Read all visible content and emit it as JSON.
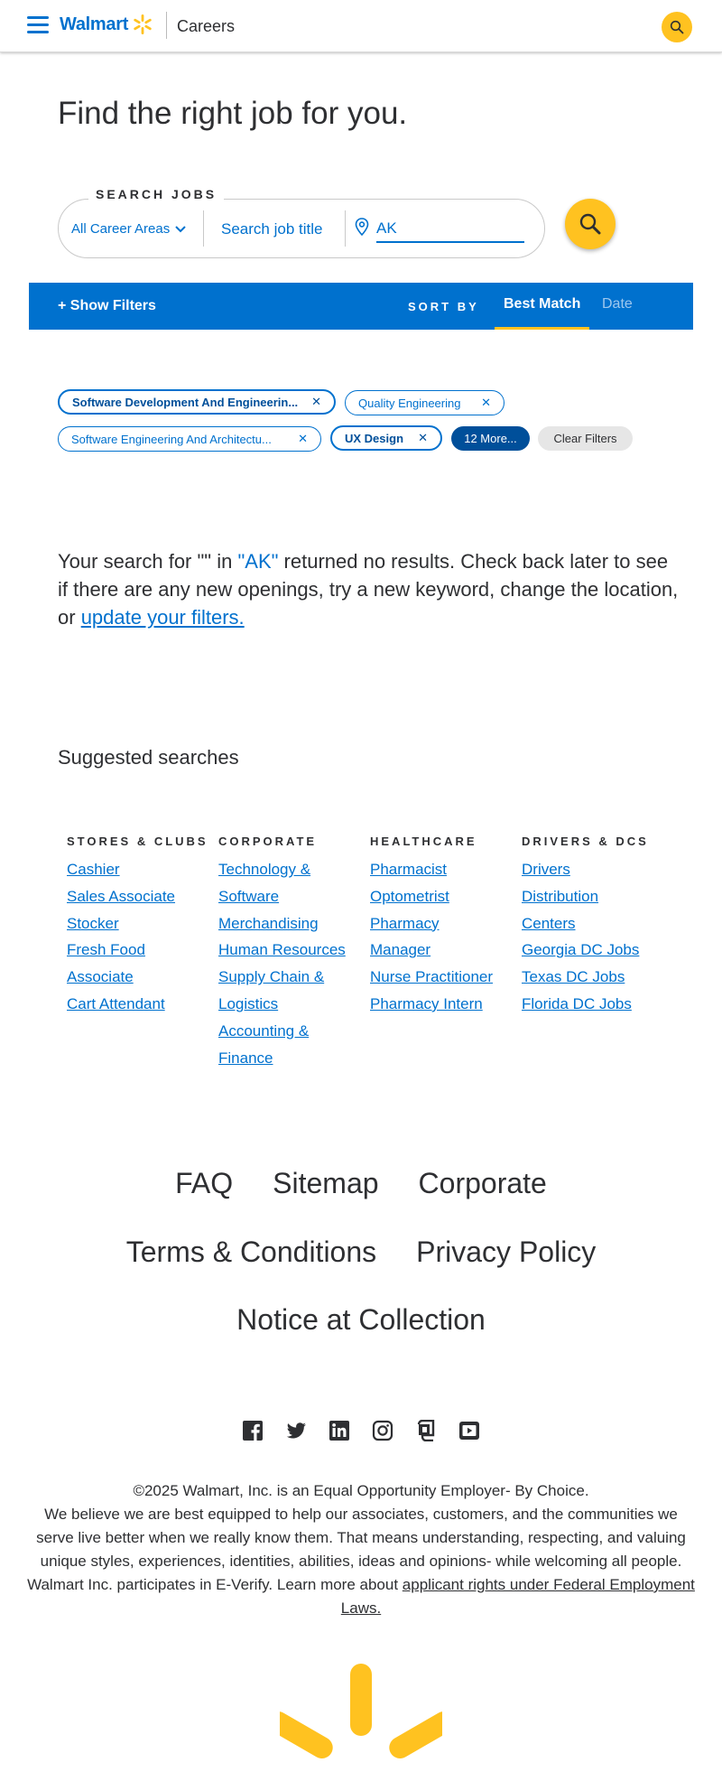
{
  "header": {
    "logo_text": "Walmart",
    "section": "Careers"
  },
  "hero": {
    "title": "Find the right job for you.",
    "search_label": "SEARCH JOBS",
    "career_area": "All Career Areas",
    "job_title_placeholder": "Search job title",
    "location_value": "AK"
  },
  "filter_bar": {
    "show_filters": "+ Show Filters",
    "sort_by": "SORT BY",
    "sort_best": "Best Match",
    "sort_date": "Date"
  },
  "chips": [
    {
      "label": "Software Development And Engineerin...",
      "bold": true
    },
    {
      "label": "Quality Engineering",
      "bold": false
    },
    {
      "label": "Software Engineering And Architectu...",
      "bold": false
    },
    {
      "label": "UX Design",
      "bold": true
    }
  ],
  "chip_more": "12 More...",
  "chip_clear": "Clear Filters",
  "no_results": {
    "prefix": "Your search for \"\" in ",
    "location": "\"AK\"",
    "middle": " returned no results. Check back later to see if there are any new openings, try a new keyword, change the location, or ",
    "link": "update your filters."
  },
  "suggested": {
    "title": "Suggested searches",
    "columns": [
      {
        "heading": "STORES & CLUBS",
        "links": [
          "Cashier",
          "Sales Associate",
          "Stocker",
          "Fresh Food",
          "Associate",
          "Cart Attendant"
        ]
      },
      {
        "heading": "CORPORATE",
        "links": [
          "Technology &",
          "Software",
          "Merchandising",
          "Human Resources",
          "Supply Chain &",
          "Logistics",
          "Accounting &",
          "Finance"
        ]
      },
      {
        "heading": "HEALTHCARE",
        "links": [
          "Pharmacist",
          "Optometrist",
          "Pharmacy",
          "Manager",
          "Nurse Practitioner",
          "Pharmacy Intern"
        ]
      },
      {
        "heading": "DRIVERS & DCS",
        "links": [
          "Drivers",
          "Distribution",
          "Centers",
          "Georgia DC Jobs",
          "Texas DC Jobs",
          "Florida DC Jobs"
        ]
      }
    ]
  },
  "footer": {
    "links_row1": [
      "FAQ",
      "Sitemap",
      "Corporate"
    ],
    "links_row2": [
      "Terms & Conditions",
      "Privacy Policy"
    ],
    "links_row3": [
      "Notice at Collection"
    ],
    "social_icons": [
      "facebook-icon",
      "twitter-icon",
      "linkedin-icon",
      "instagram-icon",
      "glassdoor-icon",
      "youtube-icon"
    ],
    "legal_line1": "©2025 Walmart, Inc. is an Equal Opportunity Employer- By Choice.",
    "legal_body": "We believe we are best equipped to help our associates, customers, and the communities we serve live better when we really know them. That means understanding, respecting, and valuing unique styles, experiences, identities, abilities, ideas and opinions- while welcoming all people. Walmart Inc. participates in E-Verify. Learn more about ",
    "legal_link": "applicant rights under Federal Employment Laws."
  },
  "colors": {
    "brand_blue": "#0071ce",
    "dark_blue": "#004f9a",
    "spark_yellow": "#ffc220"
  }
}
